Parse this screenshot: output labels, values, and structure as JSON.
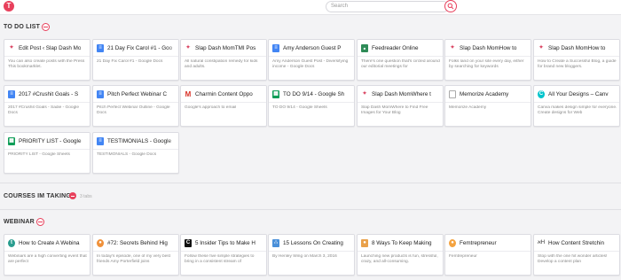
{
  "header": {
    "search_placeholder": "Search"
  },
  "colors": {
    "accent": "#e8405c"
  },
  "sections": [
    {
      "title": "TO DO LIST",
      "cards": [
        {
          "title": "Edit Post ‹ Slap Dash Mo",
          "icon": "quill-icon",
          "desc": "You can also create posts with the Press This bookmarklet."
        },
        {
          "title": "21 Day Fix Carol #1 - Goo",
          "icon": "docs-icon",
          "desc": "21 Day Fix Carol #1 - Google Docs"
        },
        {
          "title": "Slap Dash MomTMI Pos",
          "icon": "quill-icon",
          "desc": "All natural constipation remedy for kids and adults."
        },
        {
          "title": "Amy Anderson Guest P",
          "icon": "docs-icon",
          "desc": "Amy Anderson Guest Post - Diversifying income - Google Docs"
        },
        {
          "title": "Feedreader Online",
          "icon": "feedreader-icon",
          "desc": "There's one question that's circled around our editorial meetings for"
        },
        {
          "title": "Slap Dash MomHow to",
          "icon": "quill-icon",
          "desc": "Folks land on your site every day, either by searching for keywords"
        },
        {
          "title": "Slap Dash MomHow to",
          "icon": "quill-icon",
          "desc": "How to Create a Successful Blog, a guide for brand new bloggers."
        }
      ]
    },
    {
      "cards": [
        {
          "title": "2017 #Crushit Goals - S",
          "icon": "docs-icon",
          "desc": "2017 #Crushit Goals - Sadie - Google Docs"
        },
        {
          "title": "Pitch Perfect Webinar C",
          "icon": "docs-icon",
          "desc": "Pitch Perfect Webinar Outline - Google Docs"
        },
        {
          "title": "Charmin Content Oppo",
          "icon": "gmail-icon",
          "desc": "Google's approach to email"
        },
        {
          "title": "TO DO 9/14 - Google Sh",
          "icon": "sheets-icon",
          "desc": "TO DO 9/14 - Google Sheets"
        },
        {
          "title": "Slap Dash MomWhere t",
          "icon": "quill-icon",
          "desc": "Slap Dash MomWhere to Find Free Images for Your Blog"
        },
        {
          "title": "Memorize Academy",
          "icon": "page-icon",
          "desc": "Memorize Academy"
        },
        {
          "title": "All Your Designs – Canv",
          "icon": "canva-icon",
          "desc": "Canva makes design simple for everyone. Create designs for Web"
        }
      ]
    },
    {
      "cards": [
        {
          "title": "PRIORITY LIST - Google",
          "icon": "sheets-icon",
          "desc": "PRIORITY LIST - Google Sheets"
        },
        {
          "title": "TESTIMONIALS - Google",
          "icon": "docs-icon",
          "desc": "TESTIMONIALS - Google Docs"
        }
      ]
    },
    {
      "title": "COURSES IM TAKING",
      "count": "3 tabs"
    },
    {
      "title": "WEBINAR",
      "cards": [
        {
          "title": "How to Create A Webina",
          "icon": "teachable-icon",
          "desc": "Webinars are a high converting event that are perfect"
        },
        {
          "title": "#72: Secrets Behind Hig",
          "icon": "podcast-icon",
          "desc": "In today's episode, one of my very best friends Amy Porterfield joins"
        },
        {
          "title": "5 Insider Tips to Make H",
          "icon": "c-icon",
          "desc": "Follow these five simple strategies to bring in a consistent stream of"
        },
        {
          "title": "15 Lessons On Creating",
          "icon": "chart-icon",
          "desc": "By Henley Wing on March 3, 2016"
        },
        {
          "title": "8 Ways To Keep Making",
          "icon": "photo-icon",
          "desc": "Launching new products is fun, stressful, crazy, and all-consuming."
        },
        {
          "title": "Femtrepreneur",
          "icon": "femtrepreneur-icon",
          "desc": "Femtrepreneur"
        },
        {
          "title": "How Content Stretchin",
          "icon": "ah-icon",
          "desc": "Stop with the one hit wonder articles! Develop a content plan"
        }
      ]
    }
  ]
}
